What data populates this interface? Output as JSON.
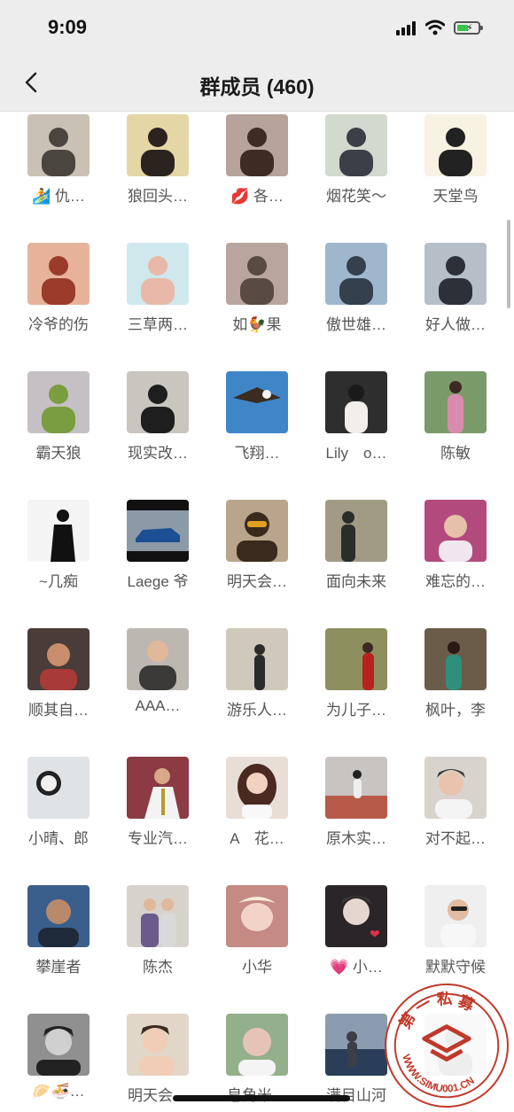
{
  "status_bar": {
    "time": "9:09"
  },
  "nav": {
    "title": "群成员 (460)"
  },
  "members": [
    {
      "name": "🏄 仇…",
      "bg": "#c9c2b4",
      "fg": "#4b4540"
    },
    {
      "name": "狼回头…",
      "bg": "#e5d6a6",
      "fg": "#2a2320"
    },
    {
      "name": "💋 各…",
      "bg": "#b7a39a",
      "fg": "#3e2c24"
    },
    {
      "name": "烟花笑～",
      "bg": "#d2d9cf",
      "fg": "#3b3f46"
    },
    {
      "name": "天堂鸟",
      "bg": "#f7f2e2",
      "fg": "#222222"
    },
    {
      "name": "冷爷的伤",
      "bg": "#e6b39a",
      "fg": "#9a3b2c"
    },
    {
      "name": "三草两…",
      "bg": "#cfe8ee",
      "fg": "#e9b8a8"
    },
    {
      "name": "如🐓果",
      "bg": "#b9a59d",
      "fg": "#5a4a44"
    },
    {
      "name": "傲世雄…",
      "bg": "#9fb7cc",
      "fg": "#34404e"
    },
    {
      "name": "好人做…",
      "bg": "#b6bec8",
      "fg": "#2d3038"
    },
    {
      "name": "霸天狼",
      "bg": "#c5c0c4",
      "fg": "#7a9d40"
    },
    {
      "name": "现实改…",
      "bg": "#c9c5bf",
      "fg": "#1e1e1e"
    },
    {
      "name": "飞翔…",
      "bg": "#3f86c9",
      "fg": "#3a2c20"
    },
    {
      "name": "Lily　o…",
      "bg": "#2e2e2e",
      "fg": "#f2eeea"
    },
    {
      "name": "陈敏",
      "bg": "#7b9a6a",
      "fg": "#d78cae"
    },
    {
      "name": "~几痴",
      "bg": "#f4f4f4",
      "fg": "#111111"
    },
    {
      "name": "Laege 爷",
      "bg": "#8c9aa8",
      "fg": "#1d4f94"
    },
    {
      "name": "明天会…",
      "bg": "#b9a58c",
      "fg": "#3a2a1e"
    },
    {
      "name": "面向未来",
      "bg": "#a19b85",
      "fg": "#2a2e2a"
    },
    {
      "name": "难忘的…",
      "bg": "#b24a7e",
      "fg": "#f0e6ee"
    },
    {
      "name": "顺其自…",
      "bg": "#4a3c38",
      "fg": "#c88d6c"
    },
    {
      "name": "AAA…",
      "bg": "#bdb7b1",
      "fg": "#3b3a39"
    },
    {
      "name": "游乐人…",
      "bg": "#cfc9bb",
      "fg": "#2b2b2b"
    },
    {
      "name": "为儿子…",
      "bg": "#8e8f5f",
      "fg": "#b8221e"
    },
    {
      "name": "枫叶，李",
      "bg": "#6b5c4a",
      "fg": "#2f8f7c"
    },
    {
      "name": "小晴、郎",
      "bg": "#dfe3e6",
      "fg": "#222222"
    },
    {
      "name": "专业汽…",
      "bg": "#8c3a44",
      "fg": "#f3f3f3"
    },
    {
      "name": "A　花…",
      "bg": "#e8ded6",
      "fg": "#4a2a20"
    },
    {
      "name": "原木实…",
      "bg": "#c8c4c2",
      "fg": "#b85a4a"
    },
    {
      "name": "对不起…",
      "bg": "#d9d3cd",
      "fg": "#3b3b3b"
    },
    {
      "name": "攀崖者",
      "bg": "#3a5f8c",
      "fg": "#b88a6c"
    },
    {
      "name": "陈杰",
      "bg": "#d8d2cc",
      "fg": "#6b5a8c"
    },
    {
      "name": "小华",
      "bg": "#c58a84",
      "fg": "#f3d2c8"
    },
    {
      "name": "💗 小…",
      "bg": "#2a2528",
      "fg": "#e6d6d0"
    },
    {
      "name": "默默守候",
      "bg": "#efefef",
      "fg": "#222222"
    },
    {
      "name": "🥟🍜…",
      "bg": "#909090",
      "fg": "#222222"
    },
    {
      "name": "明天会…",
      "bg": "#e2d6c8",
      "fg": "#3b2a20"
    },
    {
      "name": "皂角米…",
      "bg": "#93b08a",
      "fg": "#e6c4b4"
    },
    {
      "name": "满目山河",
      "bg": "#8c9cb0",
      "fg": "#3a3f48"
    },
    {
      "name": "",
      "bg": "#e8e8e8",
      "fg": "#bbbbbb"
    }
  ],
  "watermark": {
    "top_text": "第 一 私 募",
    "bottom_text": "WWW.SIMU001.CN",
    "color": "#c0392b"
  }
}
